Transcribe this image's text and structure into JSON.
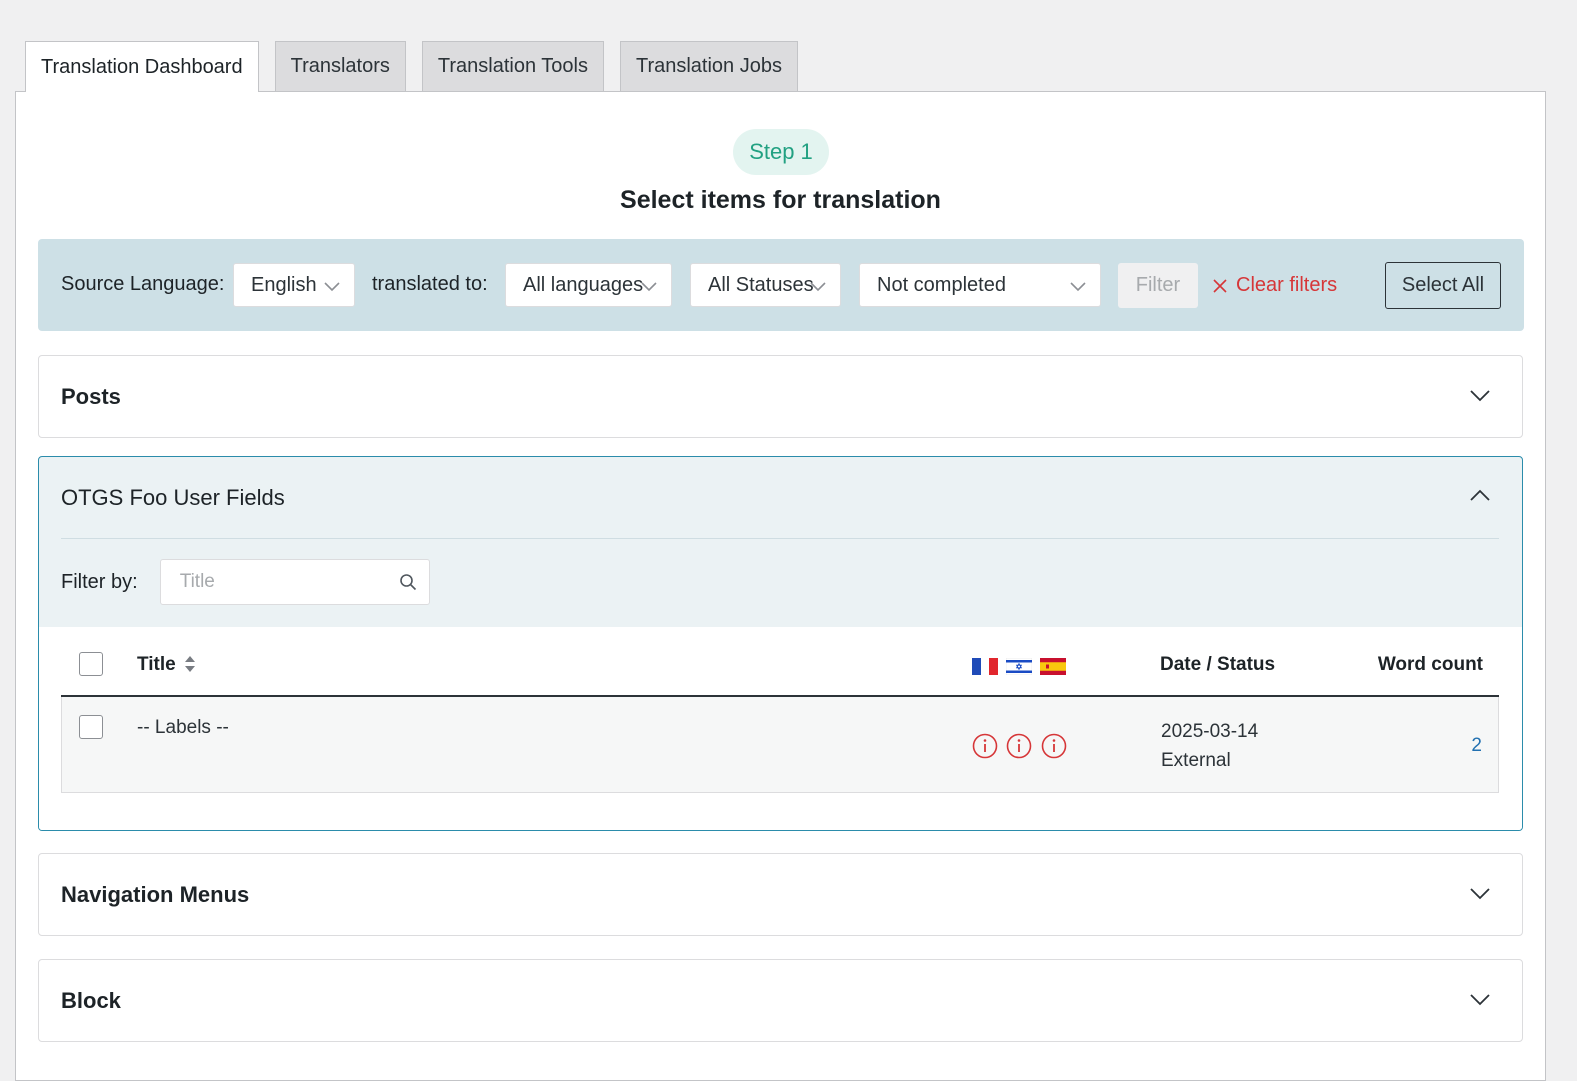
{
  "tabs": [
    "Translation Dashboard",
    "Translators",
    "Translation Tools",
    "Translation Jobs"
  ],
  "step": {
    "badge": "Step 1",
    "heading": "Select items for translation"
  },
  "filters": {
    "source_label": "Source Language:",
    "source_value": "English",
    "target_label": "translated to:",
    "target_value": "All languages",
    "status_value": "All Statuses",
    "completion_value": "Not completed",
    "filter_button": "Filter",
    "clear_label": "Clear filters",
    "select_all": "Select All"
  },
  "sections": {
    "posts": "Posts",
    "otgs": "OTGS Foo User Fields",
    "nav": "Navigation Menus",
    "block": "Block"
  },
  "otgs_panel": {
    "filter_label": "Filter by:",
    "search_placeholder": "Title",
    "columns": {
      "title": "Title",
      "date_status": "Date / Status",
      "word_count": "Word count"
    },
    "flags": [
      "french-flag",
      "israeli-flag",
      "spanish-flag"
    ],
    "rows": [
      {
        "title": "-- Labels --",
        "date": "2025-03-14",
        "status": "External",
        "word_count": "2"
      }
    ]
  },
  "colors": {
    "accent": "#22a182",
    "danger": "#d63638",
    "link": "#2271b1",
    "open_border": "#2b8cab"
  }
}
